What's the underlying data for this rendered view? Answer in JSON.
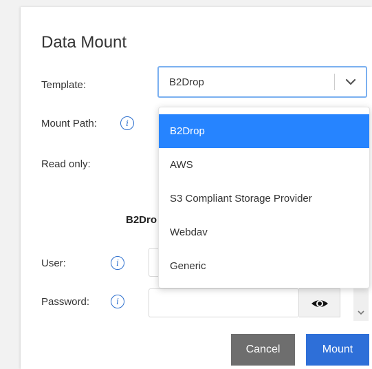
{
  "dialog": {
    "title": "Data Mount",
    "template_label": "Template:",
    "mount_path_label": "Mount Path:",
    "read_only_label": "Read only:",
    "section_heading": "B2Drop",
    "user_label": "User:",
    "password_label": "Password:",
    "info_glyph": "i"
  },
  "template_select": {
    "value": "B2Drop",
    "options": [
      "B2Drop",
      "AWS",
      "S3 Compliant Storage Provider",
      "Webdav",
      "Generic"
    ],
    "selected_index": 0
  },
  "buttons": {
    "cancel": "Cancel",
    "mount": "Mount"
  },
  "colors": {
    "accent": "#2684ff",
    "mount_button": "#2e6fd8",
    "cancel_button": "#6e6e6e",
    "info_icon": "#2c6fce"
  },
  "icons": [
    "info-icon",
    "chevron-down-icon",
    "eye-icon",
    "scroll-down-icon"
  ]
}
